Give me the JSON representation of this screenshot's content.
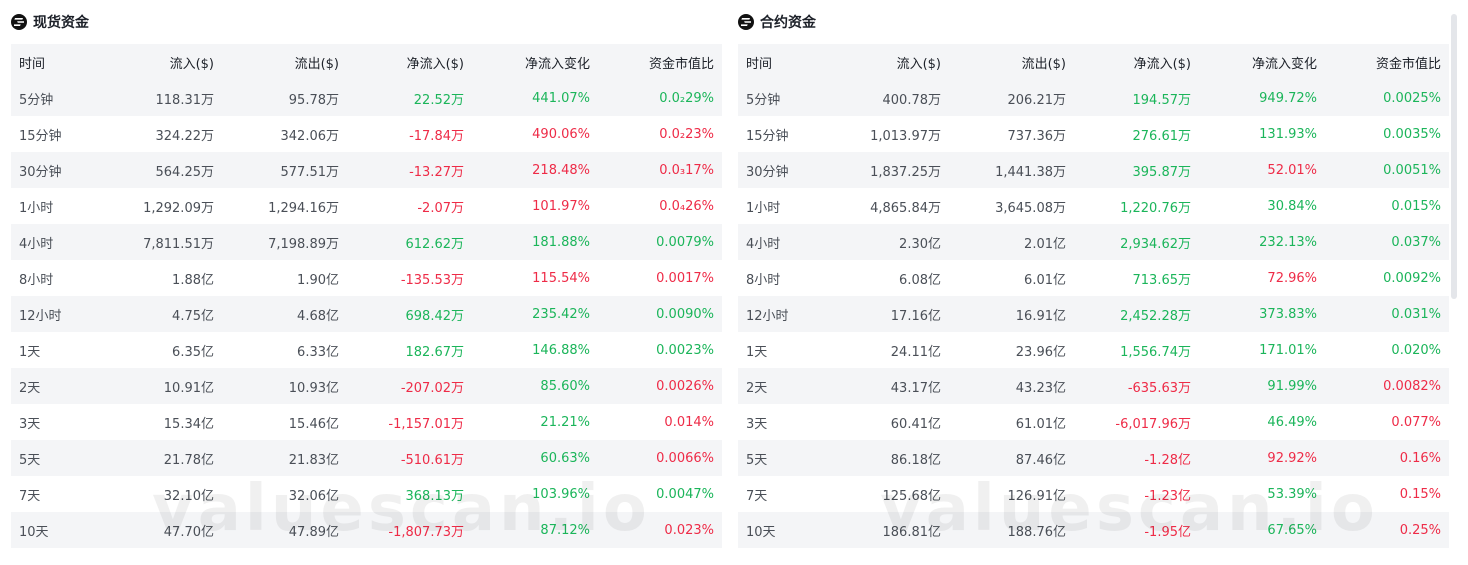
{
  "spot": {
    "title": "现货资金",
    "columns": [
      "时间",
      "流入($)",
      "流出($)",
      "净流入($)",
      "净流入变化",
      "资金市值比"
    ],
    "rows": [
      {
        "period": "5分钟",
        "inflow": "118.31万",
        "outflow": "95.78万",
        "net": "22.52万",
        "net_dir": "pos",
        "change": "441.07%",
        "change_dir": "pos",
        "ratio": "0.0₂29%",
        "ratio_dir": "pos"
      },
      {
        "period": "15分钟",
        "inflow": "324.22万",
        "outflow": "342.06万",
        "net": "-17.84万",
        "net_dir": "neg",
        "change": "490.06%",
        "change_dir": "neg",
        "ratio": "0.0₂23%",
        "ratio_dir": "neg"
      },
      {
        "period": "30分钟",
        "inflow": "564.25万",
        "outflow": "577.51万",
        "net": "-13.27万",
        "net_dir": "neg",
        "change": "218.48%",
        "change_dir": "neg",
        "ratio": "0.0₃17%",
        "ratio_dir": "neg"
      },
      {
        "period": "1小时",
        "inflow": "1,292.09万",
        "outflow": "1,294.16万",
        "net": "-2.07万",
        "net_dir": "neg",
        "change": "101.97%",
        "change_dir": "neg",
        "ratio": "0.0₄26%",
        "ratio_dir": "neg"
      },
      {
        "period": "4小时",
        "inflow": "7,811.51万",
        "outflow": "7,198.89万",
        "net": "612.62万",
        "net_dir": "pos",
        "change": "181.88%",
        "change_dir": "pos",
        "ratio": "0.0079%",
        "ratio_dir": "pos"
      },
      {
        "period": "8小时",
        "inflow": "1.88亿",
        "outflow": "1.90亿",
        "net": "-135.53万",
        "net_dir": "neg",
        "change": "115.54%",
        "change_dir": "neg",
        "ratio": "0.0017%",
        "ratio_dir": "neg"
      },
      {
        "period": "12小时",
        "inflow": "4.75亿",
        "outflow": "4.68亿",
        "net": "698.42万",
        "net_dir": "pos",
        "change": "235.42%",
        "change_dir": "pos",
        "ratio": "0.0090%",
        "ratio_dir": "pos"
      },
      {
        "period": "1天",
        "inflow": "6.35亿",
        "outflow": "6.33亿",
        "net": "182.67万",
        "net_dir": "pos",
        "change": "146.88%",
        "change_dir": "pos",
        "ratio": "0.0023%",
        "ratio_dir": "pos"
      },
      {
        "period": "2天",
        "inflow": "10.91亿",
        "outflow": "10.93亿",
        "net": "-207.02万",
        "net_dir": "neg",
        "change": "85.60%",
        "change_dir": "pos",
        "ratio": "0.0026%",
        "ratio_dir": "neg"
      },
      {
        "period": "3天",
        "inflow": "15.34亿",
        "outflow": "15.46亿",
        "net": "-1,157.01万",
        "net_dir": "neg",
        "change": "21.21%",
        "change_dir": "pos",
        "ratio": "0.014%",
        "ratio_dir": "neg"
      },
      {
        "period": "5天",
        "inflow": "21.78亿",
        "outflow": "21.83亿",
        "net": "-510.61万",
        "net_dir": "neg",
        "change": "60.63%",
        "change_dir": "pos",
        "ratio": "0.0066%",
        "ratio_dir": "neg"
      },
      {
        "period": "7天",
        "inflow": "32.10亿",
        "outflow": "32.06亿",
        "net": "368.13万",
        "net_dir": "pos",
        "change": "103.96%",
        "change_dir": "pos",
        "ratio": "0.0047%",
        "ratio_dir": "pos"
      },
      {
        "period": "10天",
        "inflow": "47.70亿",
        "outflow": "47.89亿",
        "net": "-1,807.73万",
        "net_dir": "neg",
        "change": "87.12%",
        "change_dir": "pos",
        "ratio": "0.023%",
        "ratio_dir": "neg"
      }
    ]
  },
  "futures": {
    "title": "合约资金",
    "columns": [
      "时间",
      "流入($)",
      "流出($)",
      "净流入($)",
      "净流入变化",
      "资金市值比"
    ],
    "rows": [
      {
        "period": "5分钟",
        "inflow": "400.78万",
        "outflow": "206.21万",
        "net": "194.57万",
        "net_dir": "pos",
        "change": "949.72%",
        "change_dir": "pos",
        "ratio": "0.0025%",
        "ratio_dir": "pos"
      },
      {
        "period": "15分钟",
        "inflow": "1,013.97万",
        "outflow": "737.36万",
        "net": "276.61万",
        "net_dir": "pos",
        "change": "131.93%",
        "change_dir": "pos",
        "ratio": "0.0035%",
        "ratio_dir": "pos"
      },
      {
        "period": "30分钟",
        "inflow": "1,837.25万",
        "outflow": "1,441.38万",
        "net": "395.87万",
        "net_dir": "pos",
        "change": "52.01%",
        "change_dir": "neg",
        "ratio": "0.0051%",
        "ratio_dir": "pos"
      },
      {
        "period": "1小时",
        "inflow": "4,865.84万",
        "outflow": "3,645.08万",
        "net": "1,220.76万",
        "net_dir": "pos",
        "change": "30.84%",
        "change_dir": "pos",
        "ratio": "0.015%",
        "ratio_dir": "pos"
      },
      {
        "period": "4小时",
        "inflow": "2.30亿",
        "outflow": "2.01亿",
        "net": "2,934.62万",
        "net_dir": "pos",
        "change": "232.13%",
        "change_dir": "pos",
        "ratio": "0.037%",
        "ratio_dir": "pos"
      },
      {
        "period": "8小时",
        "inflow": "6.08亿",
        "outflow": "6.01亿",
        "net": "713.65万",
        "net_dir": "pos",
        "change": "72.96%",
        "change_dir": "neg",
        "ratio": "0.0092%",
        "ratio_dir": "pos"
      },
      {
        "period": "12小时",
        "inflow": "17.16亿",
        "outflow": "16.91亿",
        "net": "2,452.28万",
        "net_dir": "pos",
        "change": "373.83%",
        "change_dir": "pos",
        "ratio": "0.031%",
        "ratio_dir": "pos"
      },
      {
        "period": "1天",
        "inflow": "24.11亿",
        "outflow": "23.96亿",
        "net": "1,556.74万",
        "net_dir": "pos",
        "change": "171.01%",
        "change_dir": "pos",
        "ratio": "0.020%",
        "ratio_dir": "pos"
      },
      {
        "period": "2天",
        "inflow": "43.17亿",
        "outflow": "43.23亿",
        "net": "-635.63万",
        "net_dir": "neg",
        "change": "91.99%",
        "change_dir": "pos",
        "ratio": "0.0082%",
        "ratio_dir": "neg"
      },
      {
        "period": "3天",
        "inflow": "60.41亿",
        "outflow": "61.01亿",
        "net": "-6,017.96万",
        "net_dir": "neg",
        "change": "46.49%",
        "change_dir": "pos",
        "ratio": "0.077%",
        "ratio_dir": "neg"
      },
      {
        "period": "5天",
        "inflow": "86.18亿",
        "outflow": "87.46亿",
        "net": "-1.28亿",
        "net_dir": "neg",
        "change": "92.92%",
        "change_dir": "neg",
        "ratio": "0.16%",
        "ratio_dir": "neg"
      },
      {
        "period": "7天",
        "inflow": "125.68亿",
        "outflow": "126.91亿",
        "net": "-1.23亿",
        "net_dir": "neg",
        "change": "53.39%",
        "change_dir": "pos",
        "ratio": "0.15%",
        "ratio_dir": "neg"
      },
      {
        "period": "10天",
        "inflow": "186.81亿",
        "outflow": "188.76亿",
        "net": "-1.95亿",
        "net_dir": "neg",
        "change": "67.65%",
        "change_dir": "pos",
        "ratio": "0.25%",
        "ratio_dir": "neg"
      }
    ]
  },
  "watermark": "valuescan.io",
  "icons": {
    "coin": "solana-coin-icon"
  },
  "colors": {
    "positive": "#1bb55a",
    "negative": "#ee2b47",
    "stripe": "#f4f5f7"
  }
}
